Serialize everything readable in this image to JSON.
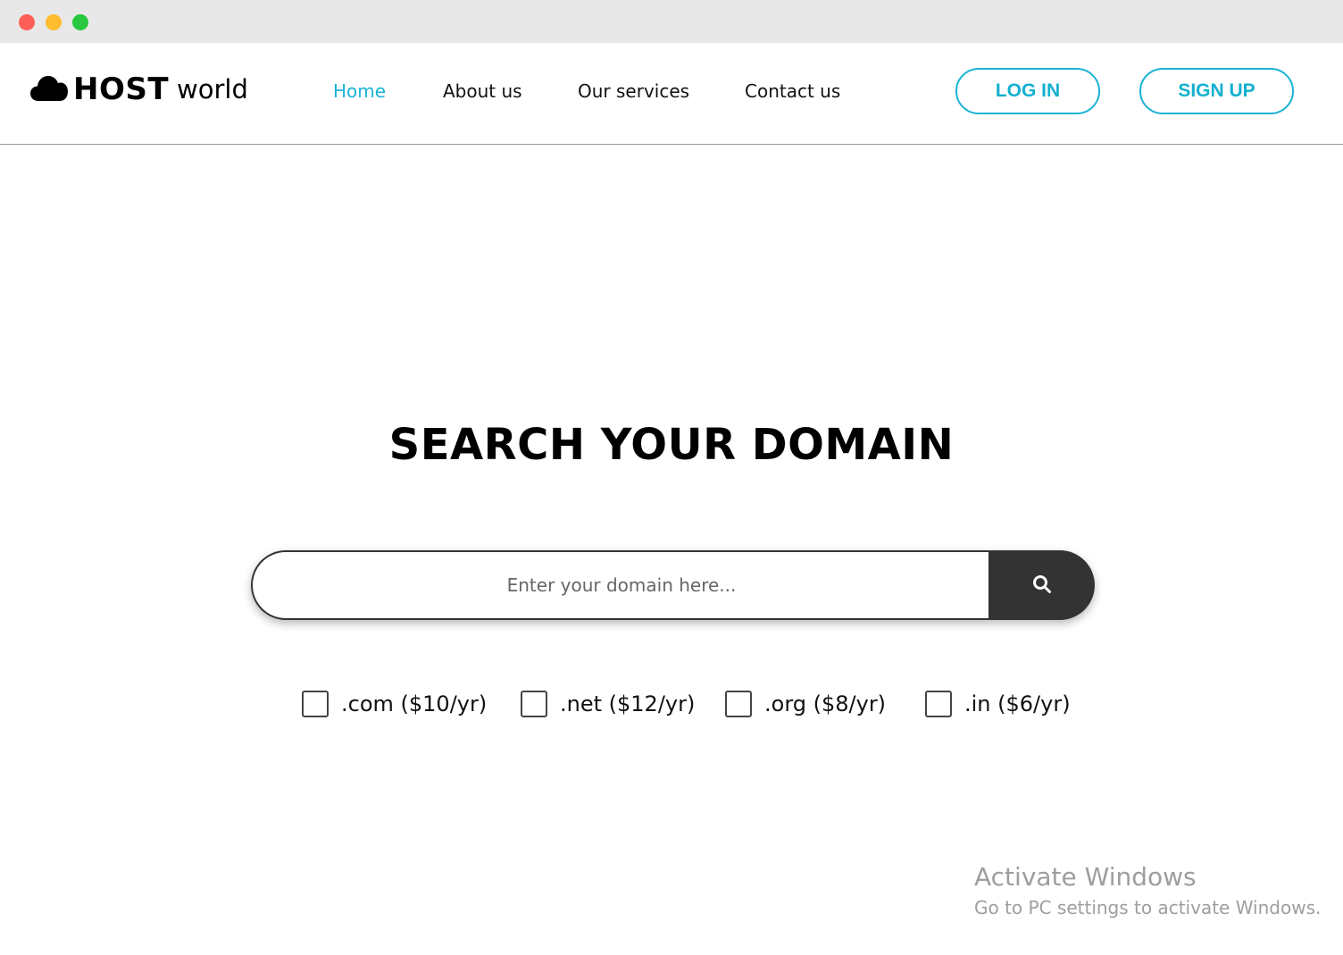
{
  "window": {
    "controls": [
      "close",
      "minimize",
      "maximize"
    ]
  },
  "brand": {
    "logo_icon": "cloud-icon",
    "name_bold": "HOST",
    "name_light": "world"
  },
  "nav": {
    "items": [
      {
        "label": "Home",
        "active": true
      },
      {
        "label": "About us",
        "active": false
      },
      {
        "label": "Our services",
        "active": false
      },
      {
        "label": "Contact us",
        "active": false
      }
    ],
    "login_label": "LOG IN",
    "signup_label": "SIGN UP"
  },
  "hero": {
    "title": "SEARCH YOUR DOMAIN"
  },
  "search": {
    "placeholder": "Enter your domain here...",
    "value": "",
    "button_icon": "search-icon"
  },
  "tlds": [
    {
      "label": ".com ($10/yr)",
      "checked": false
    },
    {
      "label": ".net ($12/yr)",
      "checked": false
    },
    {
      "label": ".org ($8/yr)",
      "checked": false
    },
    {
      "label": ".in ($6/yr)",
      "checked": false
    }
  ],
  "watermark": {
    "title": "Activate Windows",
    "subtitle": "Go to PC settings to activate Windows."
  },
  "colors": {
    "accent": "#1ab3d4",
    "search_button": "#333333",
    "titlebar": "#e8e8e8"
  }
}
